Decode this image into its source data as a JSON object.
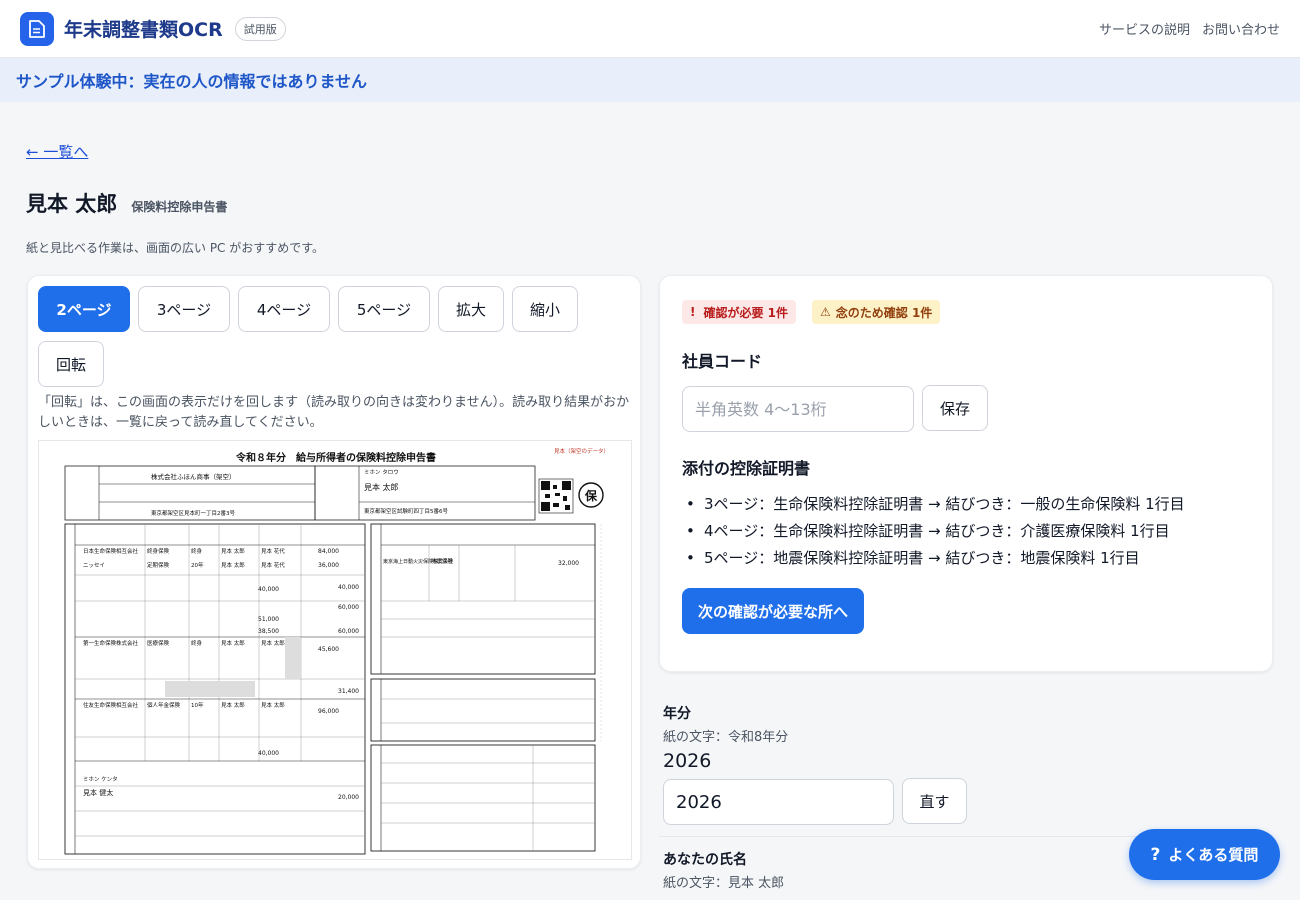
{
  "header": {
    "app_title": "年末調整書類OCR",
    "badge": "試用版",
    "nav": [
      "サービスの説明",
      "お問い合わせ"
    ]
  },
  "banner": "サンプル体験中：実在の人の情報ではありません",
  "back_link": "← 一覧へ",
  "person_name": "見本 太郎",
  "doc_type": "保険料控除申告書",
  "hint": "紙と見比べる作業は、画面の広い PC がおすすめです。",
  "viewer": {
    "buttons": [
      "2ページ",
      "3ページ",
      "4ページ",
      "5ページ",
      "拡大",
      "縮小",
      "回転"
    ],
    "rotate_note": "「回転」は、この画面の表示だけを回します（読み取りの向きは変わりません）。読み取り結果がおかしいときは、一覧に戻って読み直してください。",
    "form": {
      "title": "令和８年分　給与所得者の保険料控除申告書",
      "stamp": "保",
      "corner_note": "見本（架空のデータ）",
      "employer": "株式会社ふほん商事（架空）",
      "employer_addr": "東京都架空区見本町一丁目2番3号",
      "kana": "ミホン タロウ",
      "name": "見本 太郎",
      "address": "東京都架空区試験町四丁目5番6号",
      "rows": [
        {
          "company": "日本生命保険相互会社",
          "kind": "終身保険",
          "term": "終身",
          "holder": "見本 太郎",
          "recipient": "見本 花代",
          "amount": "84,000"
        },
        {
          "company": "ニッセイ",
          "kind": "定期保険",
          "term": "20年",
          "holder": "見本 太郎",
          "recipient": "見本 花代",
          "amount": "36,000"
        },
        {
          "company": "第一生命保険株式会社",
          "kind": "医療保険",
          "term": "終身",
          "holder": "見本 太郎",
          "recipient": "見本 太郎",
          "amount": "45,600"
        },
        {
          "company": "住友生命保険相互会社",
          "kind": "個人年金保険",
          "term": "10年",
          "holder": "見本 太郎",
          "recipient": "見本 太郎",
          "amount": "96,000"
        }
      ],
      "side_values": [
        "40,000",
        "60,000",
        "51,000",
        "38,500",
        "40,000",
        "60,000",
        "31,400",
        "40,000",
        "20,000"
      ],
      "quake_company": "東京海上日動火災保険株式会社",
      "quake_kind": "地震保険",
      "quake_amount": "32,000",
      "spouse_name": "見本 健太",
      "spouse_kana": "ミホン ケンタ"
    }
  },
  "status": {
    "need_check": "確認が必要 1件",
    "double_check": "念のため確認 1件"
  },
  "employee_code": {
    "label": "社員コード",
    "placeholder": "半角英数 4〜13桁",
    "save": "保存"
  },
  "attachments": {
    "label": "添付の控除証明書",
    "items": [
      "3ページ：生命保険料控除証明書 → 結びつき：一般の生命保険料 1行目",
      "4ページ：生命保険料控除証明書 → 結びつき：介護医療保険料 1行目",
      "5ページ：地震保険料控除証明書 → 結びつき：地震保険料 1行目"
    ],
    "next_button": "次の確認が必要な所へ"
  },
  "fields": {
    "year": {
      "label": "年分",
      "paper": "紙の文字：令和8年分",
      "value": "2026",
      "input": "2026",
      "fix": "直す"
    },
    "name": {
      "label": "あなたの氏名",
      "paper": "紙の文字：見本 太郎"
    }
  },
  "faq": "よくある質問"
}
